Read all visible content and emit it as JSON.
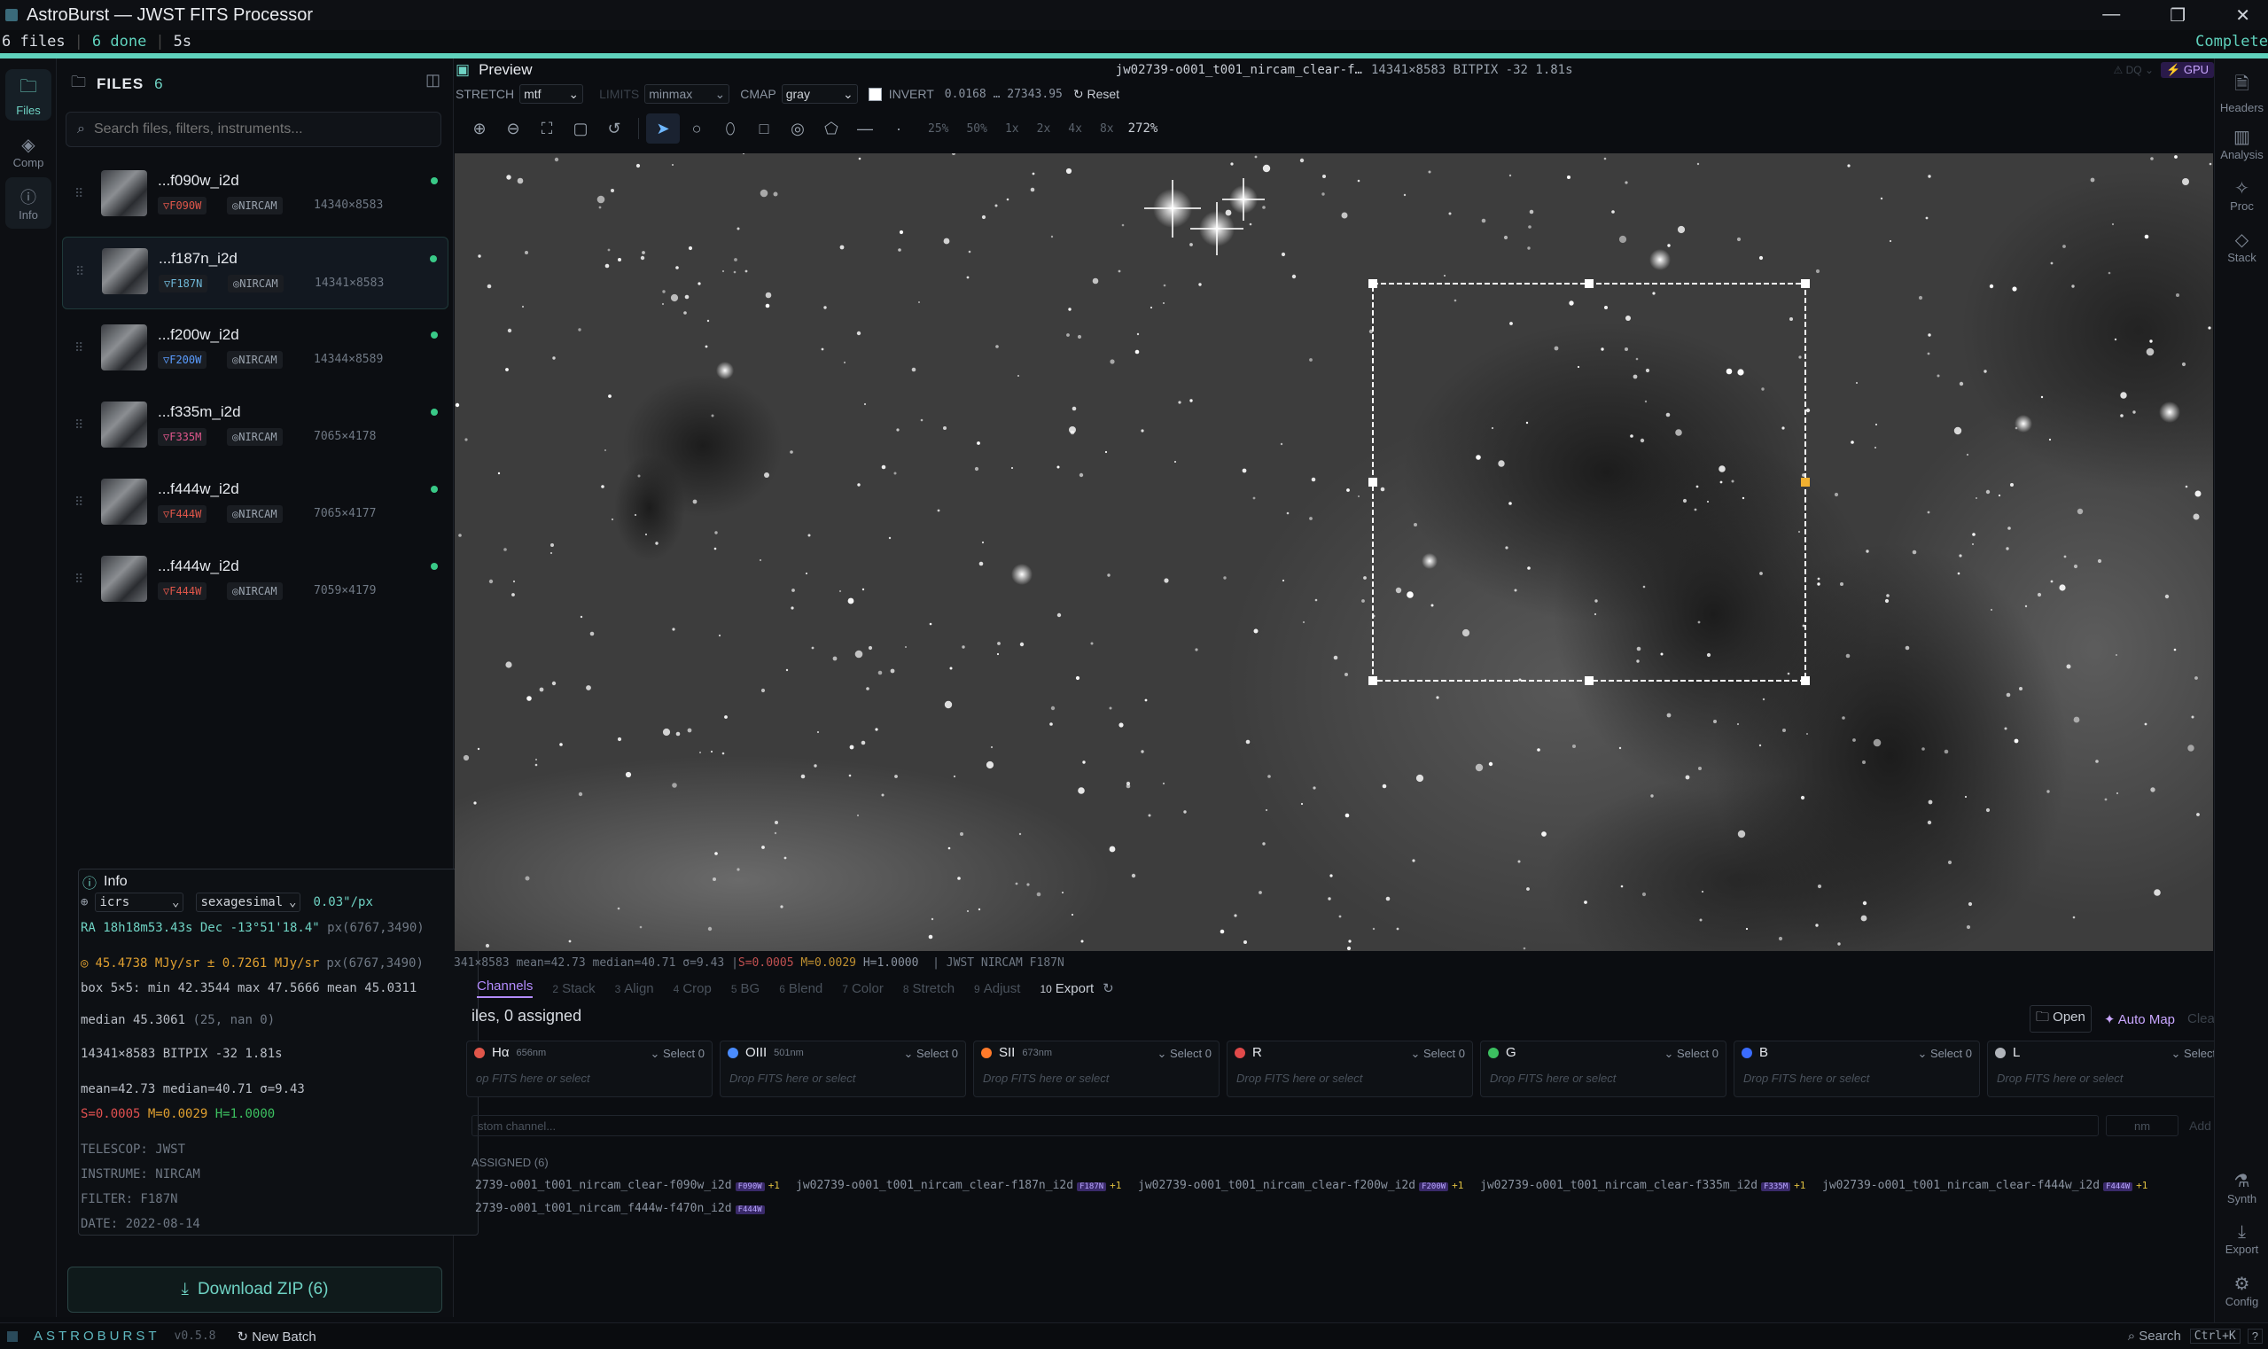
{
  "window": {
    "title": "AstroBurst — JWST FITS Processor"
  },
  "status": {
    "files": "6 files",
    "done": "6 done",
    "time": "5s",
    "complete": "Complete",
    "progress": 1.0
  },
  "rail": [
    {
      "label": "Files",
      "icon": "folder-icon"
    },
    {
      "label": "Comp",
      "icon": "layers-icon"
    },
    {
      "label": "Info",
      "icon": "info-icon"
    }
  ],
  "files_panel": {
    "title": "FILES",
    "count": "6",
    "search_placeholder": "Search files, filters, instruments...",
    "items": [
      {
        "name": "...f090w_i2d",
        "filter": "F090W",
        "instrument": "NIRCAM",
        "dims": "14340×8583",
        "filter_color": "#e0564a"
      },
      {
        "name": "...f187n_i2d",
        "filter": "F187N",
        "instrument": "NIRCAM",
        "dims": "14341×8583",
        "filter_color": "#6fb8d8"
      },
      {
        "name": "...f200w_i2d",
        "filter": "F200W",
        "instrument": "NIRCAM",
        "dims": "14344×8589",
        "filter_color": "#5a9cff"
      },
      {
        "name": "...f335m_i2d",
        "filter": "F335M",
        "instrument": "NIRCAM",
        "dims": "7065×4178",
        "filter_color": "#e0568c"
      },
      {
        "name": "...f444w_i2d",
        "filter": "F444W",
        "instrument": "NIRCAM",
        "dims": "7065×4177",
        "filter_color": "#e0564a"
      },
      {
        "name": "...f444w_i2d",
        "filter": "F444W",
        "instrument": "NIRCAM",
        "dims": "7059×4179",
        "filter_color": "#e0564a"
      }
    ]
  },
  "info": {
    "title": "Info",
    "frame": "icrs",
    "format": "sexagesimal",
    "scale": "0.03\"/px",
    "ra_dec": "RA 18h18m53.43s  Dec -13°51'18.4\"",
    "px": "px(6767,3490)",
    "value": "45.4738 MJy/sr ± 0.7261 MJy/sr",
    "value_px": "px(6767,3490)",
    "box": "box 5×5: min 42.3544  max 47.5666  mean 45.0311",
    "median": "median 45.3061",
    "median_extra": "(25, nan 0)",
    "dims": "14341×8583  BITPIX -32  1.81s",
    "stats": "mean=42.73  median=40.71  σ=9.43",
    "stf_s": "S=0.0005",
    "stf_m": "M=0.0029",
    "stf_h": "H=1.0000",
    "telescope": "TELESCOP: JWST",
    "instrume": "INSTRUME: NIRCAM",
    "filter": "FILTER: F187N",
    "date": "DATE: 2022-08-14"
  },
  "download": {
    "label": "Download ZIP (6)"
  },
  "bottom": {
    "brand": "ASTROBURST",
    "version": "v0.5.8",
    "new_batch": "New Batch",
    "search": "Search",
    "shortcut": "Ctrl+K",
    "help": "?"
  },
  "preview": {
    "title": "Preview",
    "file": "jw02739-o001_t001_nircam_clear-f…",
    "meta": "14341×8583 BITPIX -32 1.81s",
    "dq": "DQ",
    "gpu": "GPU",
    "stretch_label": "STRETCH",
    "stretch": "mtf",
    "limits_label": "LIMITS",
    "limits": "minmax",
    "cmap_label": "CMAP",
    "cmap": "gray",
    "invert_label": "INVERT",
    "range": "0.0168 … 27343.95",
    "reset": "Reset",
    "zooms": [
      "25%",
      "50%",
      "1x",
      "2x",
      "4x",
      "8x"
    ],
    "zoom_current": "272%",
    "img_status": "341×8583  mean=42.73 median=40.71 σ=9.43  |  ",
    "img_s": "S=0.0005",
    "img_m": "M=0.0029",
    "img_h": "H=1.0000",
    "img_tail": "|  JWST NIRCAM F187N"
  },
  "steps": [
    {
      "n": "",
      "label": "Channels"
    },
    {
      "n": "2",
      "label": "Stack"
    },
    {
      "n": "3",
      "label": "Align"
    },
    {
      "n": "4",
      "label": "Crop"
    },
    {
      "n": "5",
      "label": "BG"
    },
    {
      "n": "6",
      "label": "Blend"
    },
    {
      "n": "7",
      "label": "Color"
    },
    {
      "n": "8",
      "label": "Stretch"
    },
    {
      "n": "9",
      "label": "Adjust"
    },
    {
      "n": "10",
      "label": "Export"
    }
  ],
  "compose": {
    "assigned": "iles, 0 assigned",
    "open": "Open",
    "auto_map": "Auto Map",
    "clear": "Clear",
    "channels": [
      {
        "name": "Hα",
        "wl": "656nm",
        "color": "#e0564a",
        "select": "Select 0",
        "drop": "op FITS here or select"
      },
      {
        "name": "OIII",
        "wl": "501nm",
        "color": "#4a8cff",
        "select": "Select 0",
        "drop": "Drop FITS here or select"
      },
      {
        "name": "SII",
        "wl": "673nm",
        "color": "#ff7a2a",
        "select": "Select 0",
        "drop": "Drop FITS here or select"
      },
      {
        "name": "R",
        "wl": "",
        "color": "#e04a4a",
        "select": "Select 0",
        "drop": "Drop FITS here or select"
      },
      {
        "name": "G",
        "wl": "",
        "color": "#3cc060",
        "select": "Select 0",
        "drop": "Drop FITS here or select"
      },
      {
        "name": "B",
        "wl": "",
        "color": "#3a6cff",
        "select": "Select 0",
        "drop": "Drop FITS here or select"
      },
      {
        "name": "L",
        "wl": "",
        "color": "#b0b4ba",
        "select": "Select 0",
        "drop": "Drop FITS here or select"
      }
    ],
    "custom_placeholder": "stom channel...",
    "nm": "nm",
    "add": "Add",
    "unassigned_label": "ASSIGNED (6)",
    "unassigned": [
      {
        "name": "2739-o001_t001_nircam_clear-f090w_i2d",
        "tag": "F090W"
      },
      {
        "name": "jw02739-o001_t001_nircam_clear-f187n_i2d",
        "tag": "F187N"
      },
      {
        "name": "jw02739-o001_t001_nircam_clear-f200w_i2d",
        "tag": "F200W"
      },
      {
        "name": "jw02739-o001_t001_nircam_clear-f335m_i2d",
        "tag": "F335M"
      },
      {
        "name": "jw02739-o001_t001_nircam_clear-f444w_i2d",
        "tag": "F444W"
      },
      {
        "name": "2739-o001_t001_nircam_f444w-f470n_i2d",
        "tag": "F444W"
      }
    ]
  },
  "right_rail": [
    {
      "label": "Headers",
      "icon": "file-icon"
    },
    {
      "label": "Analysis",
      "icon": "chart-icon"
    },
    {
      "label": "Proc",
      "icon": "wand-icon"
    },
    {
      "label": "Stack",
      "icon": "stack-icon"
    },
    {
      "label": "Synth",
      "icon": "flask-icon"
    },
    {
      "label": "Export",
      "icon": "download-icon"
    },
    {
      "label": "Config",
      "icon": "gear-icon"
    }
  ]
}
